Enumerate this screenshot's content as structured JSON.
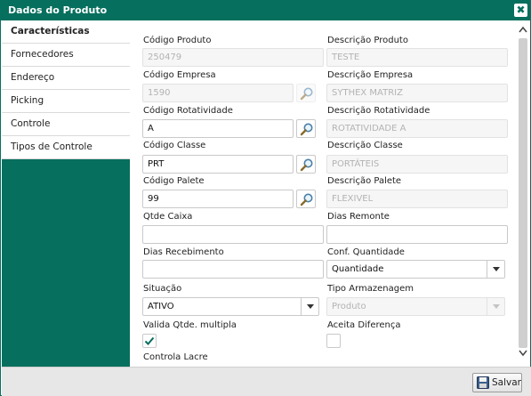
{
  "window": {
    "title": "Dados do Produto",
    "close_glyph": "✖"
  },
  "sidebar": {
    "items": [
      {
        "label": "Características"
      },
      {
        "label": "Fornecedores"
      },
      {
        "label": "Endereço"
      },
      {
        "label": "Picking"
      },
      {
        "label": "Controle"
      },
      {
        "label": "Tipos de Controle"
      }
    ]
  },
  "form": {
    "codigo_produto": {
      "label": "Código Produto",
      "value": "250479"
    },
    "descricao_produto": {
      "label": "Descrição Produto",
      "value": "TESTE"
    },
    "codigo_empresa": {
      "label": "Código Empresa",
      "value": "1590"
    },
    "descricao_empresa": {
      "label": "Descrição Empresa",
      "value": "SYTHEX MATRIZ"
    },
    "codigo_rotatividade": {
      "label": "Código Rotatividade",
      "value": "A"
    },
    "descricao_rotatividade": {
      "label": "Descrição Rotatividade",
      "value": "ROTATIVIDADE A"
    },
    "codigo_classe": {
      "label": "Código Classe",
      "value": "PRT"
    },
    "descricao_classe": {
      "label": "Descrição Classe",
      "value": "PORTÁTEIS"
    },
    "codigo_palete": {
      "label": "Código Palete",
      "value": "99"
    },
    "descricao_palete": {
      "label": "Descrição Palete",
      "value": "FLEXIVEL"
    },
    "qtde_caixa": {
      "label": "Qtde Caixa",
      "value": ""
    },
    "dias_remonte": {
      "label": "Dias Remonte",
      "value": ""
    },
    "dias_recebimento": {
      "label": "Dias Recebimento",
      "value": ""
    },
    "conf_quantidade": {
      "label": "Conf. Quantidade",
      "value": "Quantidade"
    },
    "situacao": {
      "label": "Situação",
      "value": "ATIVO"
    },
    "tipo_armazenagem": {
      "label": "Tipo Armazenagem",
      "value": "Produto"
    },
    "valida_qtde_multipla": {
      "label": "Valida Qtde. multipla",
      "checked": true
    },
    "aceita_diferenca": {
      "label": "Aceita Diferença",
      "checked": false
    },
    "controla_lacre": {
      "label": "Controla Lacre"
    }
  },
  "footer": {
    "save_label": "Salvar"
  },
  "colors": {
    "brand": "#066f5e",
    "disabled_bg": "#f6f6f6",
    "check": "#066f5e"
  },
  "icons": {
    "lookup": "magnifier-icon",
    "dropdown": "chevron-down-icon",
    "save": "floppy-disk-icon",
    "close": "close-icon"
  }
}
